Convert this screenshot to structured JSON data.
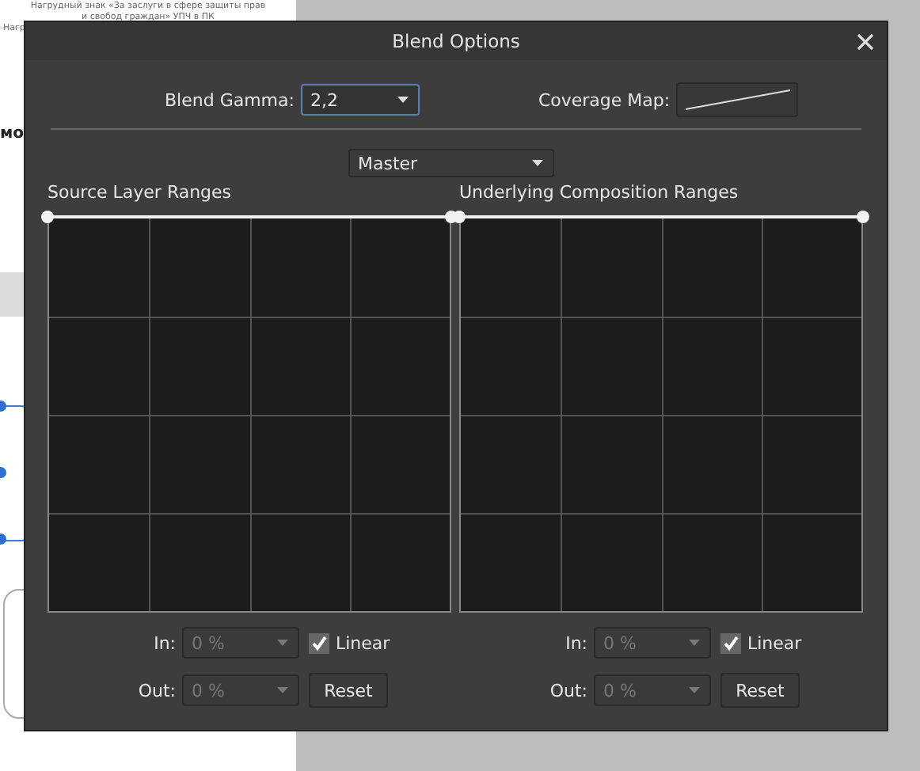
{
  "background_document": {
    "caption_lines": [
      "Нагрудный знак «За заслуги в сфере защиты прав",
      "и свобод граждан» УПЧ в ПК"
    ],
    "cut_texts": [
      "Нагр",
      "мо"
    ]
  },
  "dialog": {
    "title": "Blend Options",
    "blend_gamma": {
      "label": "Blend Gamma:",
      "value": "2,2"
    },
    "coverage_map": {
      "label": "Coverage Map:"
    },
    "channel": {
      "value": "Master"
    },
    "panels": [
      {
        "title": "Source Layer Ranges",
        "in": {
          "label": "In:",
          "value": "0 %"
        },
        "linear": {
          "label": "Linear",
          "checked": true
        },
        "out": {
          "label": "Out:",
          "value": "0 %"
        },
        "reset": "Reset"
      },
      {
        "title": "Underlying Composition Ranges",
        "in": {
          "label": "In:",
          "value": "0 %"
        },
        "linear": {
          "label": "Linear",
          "checked": true
        },
        "out": {
          "label": "Out:",
          "value": "0 %"
        },
        "reset": "Reset"
      }
    ]
  }
}
